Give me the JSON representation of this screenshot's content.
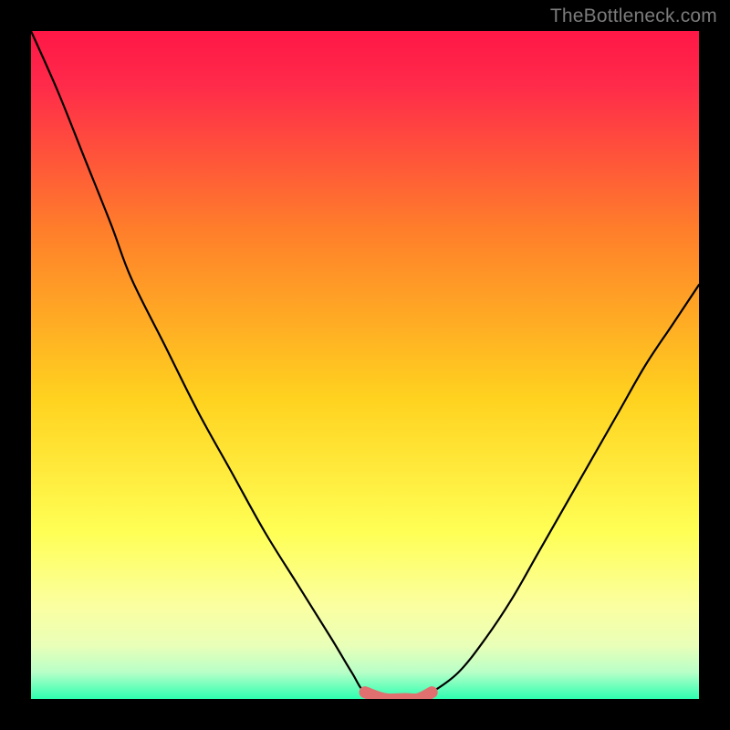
{
  "watermark": "TheBottleneck.com",
  "colors": {
    "page_bg": "#000000",
    "gradient_top": "#ff1746",
    "gradient_mid1": "#ff7f2a",
    "gradient_mid2": "#ffd21f",
    "gradient_mid3": "#ffff55",
    "gradient_mid4": "#eaffb0",
    "gradient_bottom": "#2dffb0",
    "curve_stroke": "#000000",
    "highlight_stroke": "#e07070"
  },
  "chart_data": {
    "type": "line",
    "title": "",
    "xlabel": "",
    "ylabel": "",
    "xlim": [
      0,
      100
    ],
    "ylim": [
      0,
      100
    ],
    "series": [
      {
        "name": "bottleneck-curve",
        "x": [
          0,
          4,
          8,
          12,
          15,
          20,
          25,
          30,
          35,
          40,
          45,
          48,
          50,
          53,
          56,
          58,
          60,
          64,
          68,
          72,
          76,
          80,
          84,
          88,
          92,
          96,
          100
        ],
        "y": [
          100,
          91,
          81,
          71,
          63,
          53,
          43,
          34,
          25,
          17,
          9,
          4,
          1,
          0,
          0,
          0,
          1,
          4,
          9,
          15,
          22,
          29,
          36,
          43,
          50,
          56,
          62
        ]
      },
      {
        "name": "optimal-range-highlight",
        "x": [
          50,
          53,
          56,
          58,
          60
        ],
        "y": [
          1,
          0,
          0,
          0,
          1
        ]
      }
    ]
  }
}
